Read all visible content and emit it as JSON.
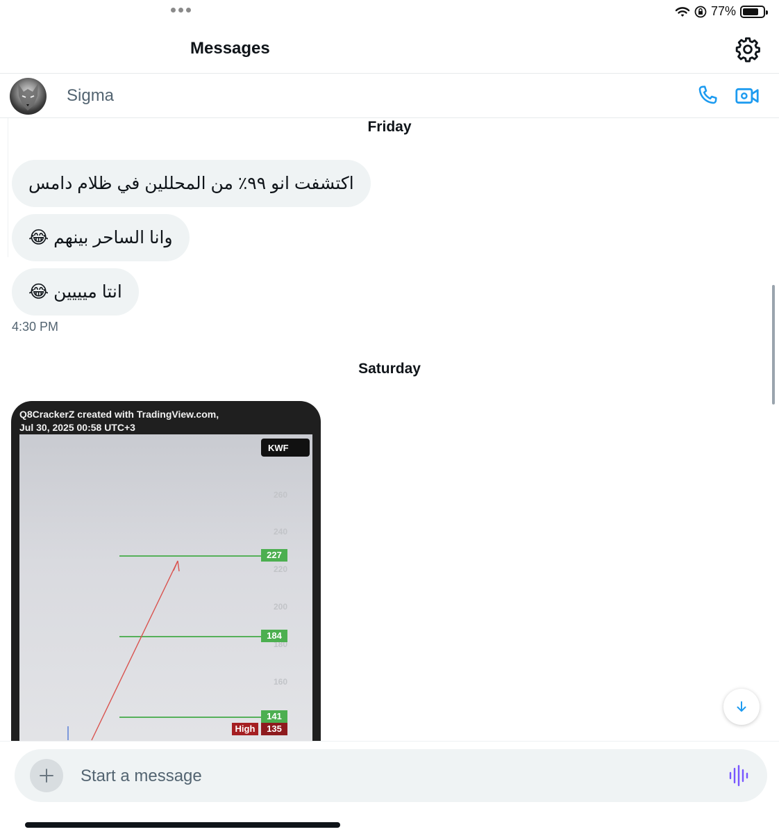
{
  "status_bar": {
    "battery_text": "77%",
    "battery_level": 0.77
  },
  "header": {
    "title": "Messages"
  },
  "conversation": {
    "name": "Sigma"
  },
  "messages": {
    "friday": {
      "day_label": "Friday",
      "bubbles": [
        "اكتشفت انو ٩٩٪ من المحللين في ظلام دامس",
        "وانا الساحر بينهم 😂",
        "انتا ميييين 😂"
      ],
      "timestamp": "4:30 PM"
    },
    "saturday": {
      "day_label": "Saturday",
      "image": {
        "caption_line1": "Q8CrackerZ created with TradingView.com,",
        "caption_line2": "Jul 30, 2025 00:58 UTC+3",
        "ticker": "KWF",
        "axis_ticks": [
          "260",
          "240",
          "220",
          "200",
          "180",
          "160"
        ],
        "price_levels": [
          "227",
          "184",
          "141"
        ],
        "high_label": "High",
        "high_value": "135"
      }
    }
  },
  "composer": {
    "placeholder": "Start a message"
  },
  "colors": {
    "accent": "#1d9bf0",
    "voice": "#7856ff",
    "bubble": "#eff3f4",
    "level_line": "#56b05a",
    "high": "#a51f22"
  }
}
